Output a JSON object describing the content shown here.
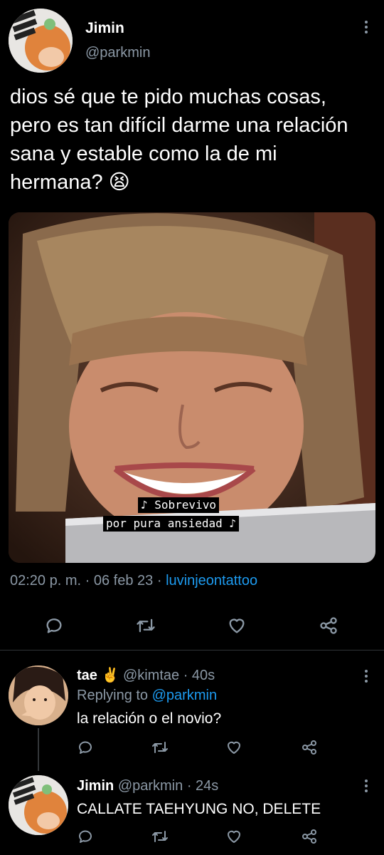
{
  "main_tweet": {
    "author_name": "Jimin",
    "author_handle": "@parkmin",
    "text": "dios sé que te pido muchas cosas, pero es tan difícil darme una relación sana y estable como la de mi hermana? 😫",
    "media": {
      "subtitle_line1": "♪ Sobrevivo",
      "subtitle_line2": "por pura ansiedad ♪"
    },
    "time": "02:20 p. m.",
    "separator": "·",
    "date": "06 feb 23",
    "source": "luvinjeontattoo"
  },
  "replies": [
    {
      "name": "tae",
      "emoji": "✌️",
      "handle": "@kimtae",
      "age": "· 40s",
      "replying_prefix": "Replying to",
      "replying_handle": "@parkmin",
      "text": "la relación o el novio?"
    },
    {
      "name": "Jimin",
      "handle": "@parkmin",
      "age": "· 24s",
      "text": "CALLATE TAEHYUNG NO, DELETE"
    }
  ],
  "icons": {
    "reply": "reply-icon",
    "retweet": "retweet-icon",
    "like": "like-icon",
    "share": "share-icon",
    "more": "more-options-icon"
  }
}
